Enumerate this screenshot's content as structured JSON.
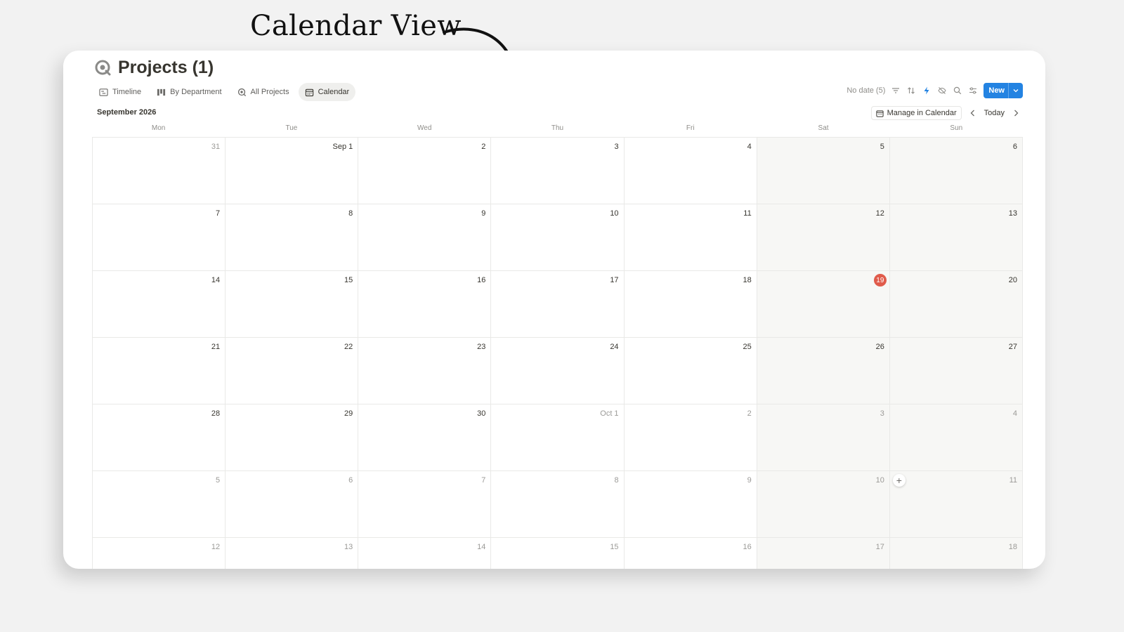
{
  "headline": "Calendar View",
  "page": {
    "title": "Projects (1)"
  },
  "tabs": [
    {
      "label": "Timeline",
      "icon": "timeline-icon"
    },
    {
      "label": "By Department",
      "icon": "board-icon"
    },
    {
      "label": "All Projects",
      "icon": "projects-icon"
    },
    {
      "label": "Calendar",
      "icon": "calendar-icon",
      "active": true
    }
  ],
  "toolbar": {
    "no_date": "No date (5)",
    "icons": [
      "filter-icon",
      "sort-icon",
      "automation-icon",
      "hide-icon",
      "search-icon",
      "settings-icon"
    ],
    "new_label": "New",
    "accent_color": "#2383e2"
  },
  "calendar": {
    "month_label": "September 2026",
    "manage_label": "Manage in Calendar",
    "today_label": "Today",
    "weekdays": [
      "Mon",
      "Tue",
      "Wed",
      "Thu",
      "Fri",
      "Sat",
      "Sun"
    ],
    "today_color": "#e05b4b",
    "weeks": [
      [
        "31",
        "Sep 1",
        "2",
        "3",
        "4",
        "5",
        "6"
      ],
      [
        "7",
        "8",
        "9",
        "10",
        "11",
        "12",
        "13"
      ],
      [
        "14",
        "15",
        "16",
        "17",
        "18",
        "19",
        "20"
      ],
      [
        "21",
        "22",
        "23",
        "24",
        "25",
        "26",
        "27"
      ],
      [
        "28",
        "29",
        "30",
        "Oct 1",
        "2",
        "3",
        "4"
      ],
      [
        "5",
        "6",
        "7",
        "8",
        "9",
        "10",
        "11"
      ],
      [
        "12",
        "13",
        "14",
        "15",
        "16",
        "17",
        "18"
      ]
    ],
    "muted_cells": [
      [
        0,
        0
      ],
      [
        4,
        3
      ],
      [
        4,
        4
      ],
      [
        4,
        5
      ],
      [
        4,
        6
      ],
      [
        5,
        0
      ],
      [
        5,
        1
      ],
      [
        5,
        2
      ],
      [
        5,
        3
      ],
      [
        5,
        4
      ],
      [
        5,
        5
      ],
      [
        5,
        6
      ],
      [
        6,
        0
      ],
      [
        6,
        1
      ],
      [
        6,
        2
      ],
      [
        6,
        3
      ],
      [
        6,
        4
      ],
      [
        6,
        5
      ],
      [
        6,
        6
      ]
    ],
    "today_cell": [
      2,
      5
    ],
    "add_cell": [
      5,
      6
    ],
    "add_glyph": "+"
  }
}
